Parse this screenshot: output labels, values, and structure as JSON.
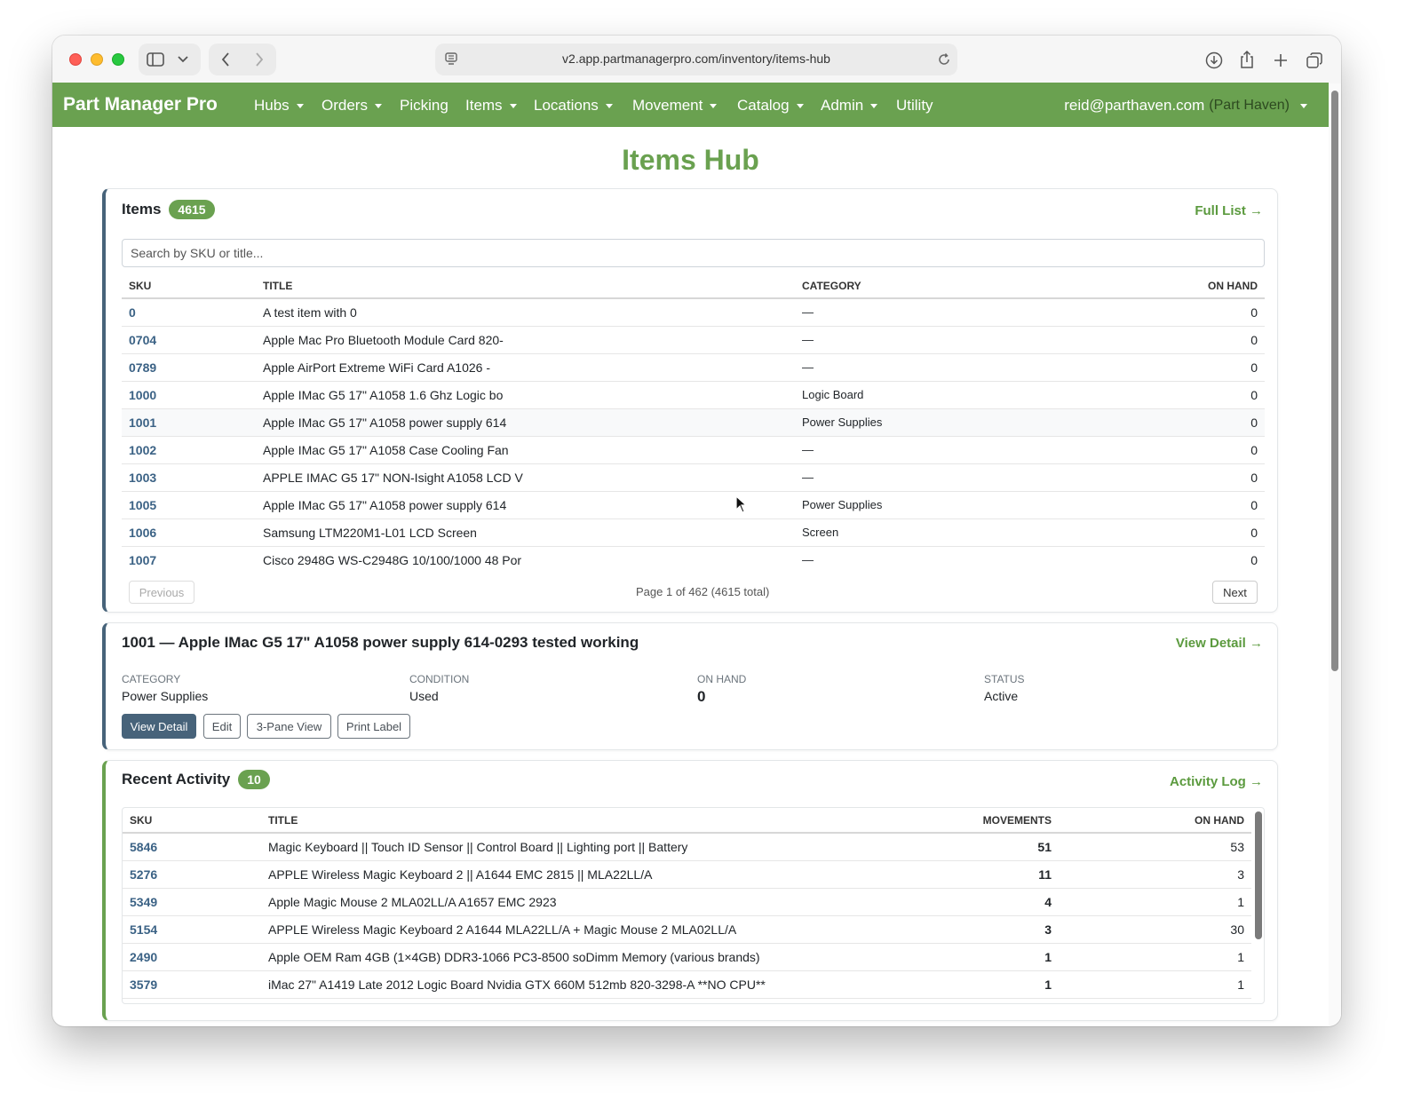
{
  "browser": {
    "url": "v2.app.partmanagerpro.com/inventory/items-hub"
  },
  "nav": {
    "brand": "Part Manager Pro",
    "items": [
      {
        "label": "Hubs",
        "dropdown": true
      },
      {
        "label": "Orders",
        "dropdown": true
      },
      {
        "label": "Picking",
        "dropdown": false
      },
      {
        "label": "Items",
        "dropdown": true
      },
      {
        "label": "Locations",
        "dropdown": true
      },
      {
        "label": "Movement",
        "dropdown": true
      },
      {
        "label": "Catalog",
        "dropdown": true
      },
      {
        "label": "Admin",
        "dropdown": true
      },
      {
        "label": "Utility",
        "dropdown": false
      }
    ],
    "user_email": "reid@parthaven.com",
    "user_org": "(Part Haven)"
  },
  "page": {
    "title": "Items Hub"
  },
  "items_card": {
    "title": "Items",
    "count": "4615",
    "link": "Full List →",
    "search_placeholder": "Search by SKU or title...",
    "columns": {
      "sku": "SKU",
      "title": "TITLE",
      "category": "CATEGORY",
      "on_hand": "ON HAND"
    },
    "rows": [
      {
        "sku": "0",
        "title": "A test item with 0",
        "category": "—",
        "on_hand": "0"
      },
      {
        "sku": "0704",
        "title": "Apple Mac Pro Bluetooth Module Card 820-",
        "category": "—",
        "on_hand": "0"
      },
      {
        "sku": "0789",
        "title": "Apple AirPort Extreme WiFi Card A1026 -",
        "category": "—",
        "on_hand": "0"
      },
      {
        "sku": "1000",
        "title": "Apple IMac G5 17\" A1058 1.6 Ghz Logic bo",
        "category": "Logic Board",
        "on_hand": "0"
      },
      {
        "sku": "1001",
        "title": "Apple IMac G5 17\" A1058 power supply 614",
        "category": "Power Supplies",
        "on_hand": "0"
      },
      {
        "sku": "1002",
        "title": "Apple IMac G5 17\" A1058 Case Cooling Fan",
        "category": "—",
        "on_hand": "0"
      },
      {
        "sku": "1003",
        "title": "APPLE IMAC G5 17\" NON-Isight A1058 LCD V",
        "category": "—",
        "on_hand": "0"
      },
      {
        "sku": "1005",
        "title": "Apple IMac G5 17\" A1058 power supply 614",
        "category": "Power Supplies",
        "on_hand": "0"
      },
      {
        "sku": "1006",
        "title": "Samsung LTM220M1-L01 LCD Screen",
        "category": "Screen",
        "on_hand": "0"
      },
      {
        "sku": "1007",
        "title": "Cisco 2948G WS-C2948G 10/100/1000 48 Por",
        "category": "—",
        "on_hand": "0"
      }
    ],
    "pager": {
      "previous": "Previous",
      "status": "Page 1 of 462 (4615 total)",
      "next": "Next"
    }
  },
  "detail_card": {
    "title": "1001 — Apple IMac G5 17\" A1058 power supply 614-0293 tested working",
    "link": "View Detail →",
    "fields": {
      "category_label": "CATEGORY",
      "category_value": "Power Supplies",
      "condition_label": "CONDITION",
      "condition_value": "Used",
      "on_hand_label": "ON HAND",
      "on_hand_value": "0",
      "status_label": "STATUS",
      "status_value": "Active"
    },
    "buttons": {
      "view_detail": "View Detail",
      "edit": "Edit",
      "three_pane": "3-Pane View",
      "print_label": "Print Label"
    }
  },
  "activity_card": {
    "title": "Recent Activity",
    "count": "10",
    "link": "Activity Log →",
    "columns": {
      "sku": "SKU",
      "title": "TITLE",
      "movements": "MOVEMENTS",
      "on_hand": "ON HAND"
    },
    "rows": [
      {
        "sku": "5846",
        "title": "Magic Keyboard || Touch ID Sensor || Control Board || Lighting port || Battery",
        "movements": "51",
        "on_hand": "53"
      },
      {
        "sku": "5276",
        "title": "APPLE Wireless Magic Keyboard 2 || A1644 EMC 2815 || MLA22LL/A",
        "movements": "11",
        "on_hand": "3"
      },
      {
        "sku": "5349",
        "title": "Apple Magic Mouse 2 MLA02LL/A A1657 EMC 2923",
        "movements": "4",
        "on_hand": "1"
      },
      {
        "sku": "5154",
        "title": "APPLE Wireless Magic Keyboard 2 A1644 MLA22LL/A + Magic Mouse 2 MLA02LL/A",
        "movements": "3",
        "on_hand": "30"
      },
      {
        "sku": "2490",
        "title": "Apple OEM Ram 4GB (1×4GB) DDR3-1066 PC3-8500 soDimm Memory (various brands)",
        "movements": "1",
        "on_hand": "1"
      },
      {
        "sku": "3579",
        "title": "iMac 27\" A1419 Late 2012 Logic Board Nvidia GTX 660M 512mb 820-3298-A **NO CPU**",
        "movements": "1",
        "on_hand": "1"
      }
    ]
  },
  "colors": {
    "brand_green": "#6aa150",
    "slate_blue": "#47637a",
    "link_blue": "#3b6285"
  }
}
